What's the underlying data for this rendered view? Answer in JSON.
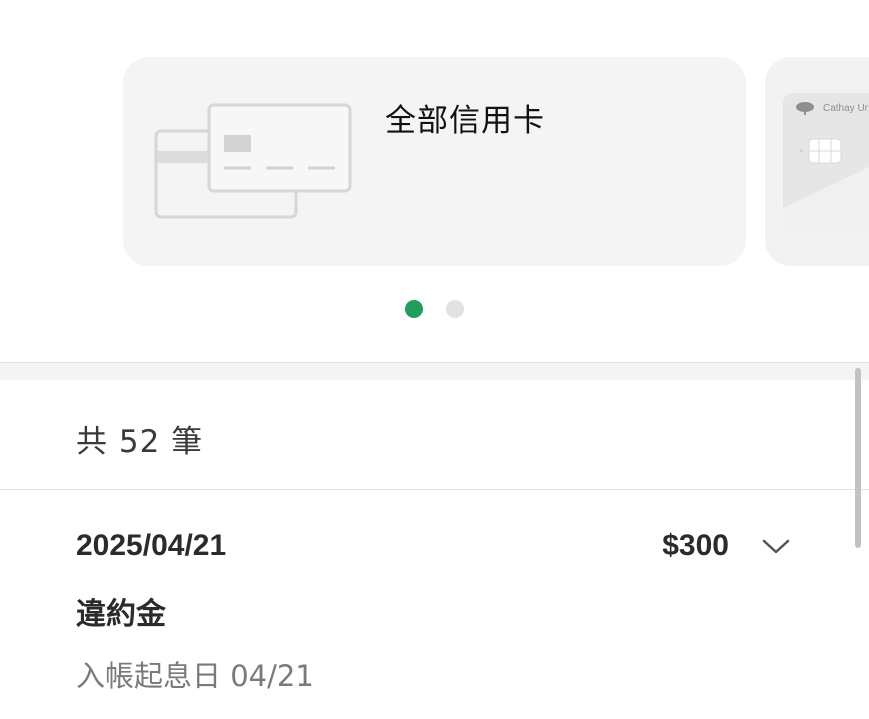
{
  "carousel": {
    "all_cards_label": "全部信用卡",
    "next_card_brand": "Cathay Ur",
    "page_count": 2,
    "active_page": 1,
    "colors": {
      "active_dot": "#1fa05a",
      "inactive_dot": "#e2e2e2",
      "card_bg": "#f4f4f4"
    }
  },
  "list": {
    "count_text": "共 52 筆",
    "transactions": [
      {
        "date": "2025/04/21",
        "amount": "$300",
        "description": "違約金",
        "posting": "入帳起息日 04/21",
        "expand_icon": "chevron-down-icon"
      }
    ]
  }
}
